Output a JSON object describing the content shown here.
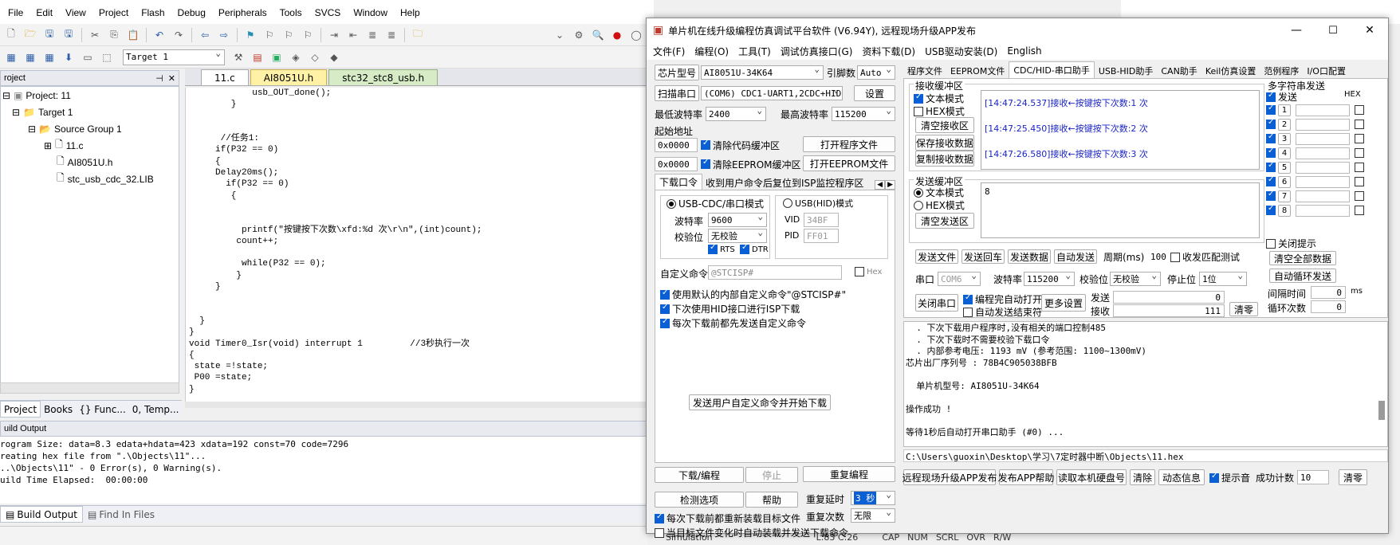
{
  "ide": {
    "menu": [
      "File",
      "Edit",
      "View",
      "Project",
      "Flash",
      "Debug",
      "Peripherals",
      "Tools",
      "SVCS",
      "Window",
      "Help"
    ],
    "target": "Target 1",
    "project_panel_title": "roject",
    "tree": [
      "Project: 11",
      "Target 1",
      "Source Group 1",
      "11.c",
      "AI8051U.h",
      "stc_usb_cdc_32.LIB"
    ],
    "tabs": [
      "11.c",
      "AI8051U.h",
      "stc32_stc8_usb.h"
    ],
    "code_lines": [
      "            usb_OUT_done();",
      "        }",
      "",
      "",
      "      //任务1:",
      "     if(P32 == 0)",
      "     {",
      "     Delay20ms();",
      "       if(P32 == 0)",
      "        {",
      "",
      "",
      "          printf(\"按键按下次数\\xfd:%d 次\\r\\n\",(int)count);",
      "         count++;",
      "",
      "          while(P32 == 0);",
      "         }",
      "     }",
      "",
      "",
      "  }",
      "}",
      "void Timer0_Isr(void) interrupt 1         //3秒执行一次",
      "{",
      " state =!state;",
      " P00 =state;",
      "}"
    ],
    "bottom_tabs": [
      "Project",
      "Books",
      "{} Func...",
      "0, Temp..."
    ],
    "build_output_title": "uild Output",
    "build_lines": [
      "rogram Size: data=8.3 edata+hdata=423 xdata=192 const=70 code=7296",
      "reating hex file from \".\\Objects\\11\"...",
      "..\\Objects\\11\" - 0 Error(s), 0 Warning(s).",
      "uild Time Elapsed:  00:00:00"
    ],
    "output_tabs": [
      "Build Output",
      "Find In Files"
    ],
    "status": [
      "Simulation",
      "L:83 C:26",
      "CAP",
      "NUM",
      "SCRL",
      "OVR",
      "R/W"
    ]
  },
  "isp": {
    "title": "单片机在线升级编程仿真调试平台软件 (V6.94Y), 远程现场升级APP发布",
    "menu": [
      "文件(F)",
      "编程(O)",
      "工具(T)",
      "调试仿真接口(G)",
      "资料下载(D)",
      "USB驱动安装(D)",
      "English"
    ],
    "chip_label": "芯片型号",
    "chip_value": "AI8051U-34K64",
    "pin_label": "引脚数",
    "pin_value": "Auto",
    "scan_port": "扫描串口",
    "port_value": "(COM6) CDC1-UART1,2CDC+HID",
    "settings": "设置",
    "min_baud_label": "最低波特率",
    "min_baud": "2400",
    "max_baud_label": "最高波特率",
    "max_baud": "115200",
    "start_addr": "起始地址",
    "addr1": "0x0000",
    "clear_code": "清除代码缓冲区",
    "open_prog": "打开程序文件",
    "addr2": "0x0000",
    "clear_eeprom": "清除EEPROM缓冲区",
    "open_eeprom": "打开EEPROM文件",
    "left_tabs": [
      "下载口令",
      "收到用户命令后复位到ISP监控程序区"
    ],
    "mode_cdc": "USB-CDC/串口模式",
    "mode_hid": "USB(HID)模式",
    "baud_label": "波特率",
    "baud": "9600",
    "parity_label": "校验位",
    "parity": "无校验",
    "vid_label": "VID",
    "vid": "34BF",
    "pid_label": "PID",
    "pid": "FF01",
    "rts": "RTS",
    "dtr": "DTR",
    "custom_label": "自定义命令",
    "custom_value": "@STCISP#",
    "hex_label": "Hex",
    "opt1": "使用默认的内部自定义命令\"@STCISP#\"",
    "opt2": "下次使用HID接口进行ISP下载",
    "opt3": "每次下载前都先发送自定义命令",
    "send_custom": "发送用户自定义命令并开始下载",
    "download": "下载/编程",
    "stop": "停止",
    "reprogram": "重复编程",
    "check": "检测选项",
    "help": "帮助",
    "retry_delay_label": "重复延时",
    "retry_delay": "3 秒",
    "retry_count_label": "重复次数",
    "retry_count": "无限",
    "reload": "每次下载前都重新装载目标文件",
    "autosend": "当目标文件变化时自动装载并发送下载命令",
    "right_tabs": [
      "程序文件",
      "EEPROM文件",
      "CDC/HID-串口助手",
      "USB-HID助手",
      "CAN助手",
      "Keil仿真设置",
      "范例程序",
      "I/O口配置"
    ],
    "recv_title": "接收缓冲区",
    "text_mode": "文本模式",
    "hex_mode": "HEX模式",
    "clear_recv": "清空接收区",
    "save_recv": "保存接收数据",
    "copy_recv": "复制接收数据",
    "recv_lines": [
      "[14:47:24.537]接收←按键按下次数:1 次",
      "[14:47:25.450]接收←按键按下次数:2 次",
      "[14:47:26.580]接收←按键按下次数:3 次"
    ],
    "send_title": "发送缓冲区",
    "clear_send": "清空发送区",
    "send_value": "8",
    "send_file": "发送文件",
    "send_enter": "发送回车",
    "send_data": "发送数据",
    "auto_send": "自动发送",
    "period_label": "周期(ms)",
    "period": "100",
    "loopback": "收发匹配测试",
    "port_label": "串口",
    "port": "COM6",
    "baud2": "115200",
    "close_port": "关闭串口",
    "auto_open": "编程完自动打开",
    "auto_end": "自动发送结束符",
    "more": "更多设置",
    "sent_label": "发送",
    "sent": "0",
    "recv_label": "接收",
    "recv": "111",
    "clear": "清零",
    "multi_title": "多字符串发送",
    "send_hdr": "发送",
    "hex_hdr": "HEX",
    "multi_rows": [
      "1",
      "2",
      "3",
      "4",
      "5",
      "6",
      "7",
      "8"
    ],
    "close_tip": "关闭提示",
    "clear_all": "清空全部数据",
    "auto_loop": "自动循环发送",
    "interval_label": "间隔时间",
    "interval": "0",
    "interval_unit": "ms",
    "loop_label": "循环次数",
    "loop": "0",
    "log_lines": [
      "  . 下次下载用户程序时,没有相关的端口控制485",
      "  . 下次下载时不需要校验下载口令",
      "  . 内部参考电压: 1193 mV (参考范围: 1100~1300mV)",
      "芯片出厂序列号 : 78B4C905038BFB",
      "",
      "  单片机型号: AI8051U-34K64",
      "",
      "操作成功 !",
      "",
      "等待1秒后自动打开串口助手 (#0) ..."
    ],
    "path": "C:\\Users\\guoxin\\Desktop\\学习\\7定时器中断\\Objects\\11.hex",
    "bottom_buttons": [
      "远程现场升级APP发布",
      "发布APP帮助",
      "读取本机硬盘号",
      "清除",
      "动态信息"
    ],
    "beep": "提示音",
    "success_label": "成功计数",
    "success": "10",
    "clear2": "清零"
  }
}
